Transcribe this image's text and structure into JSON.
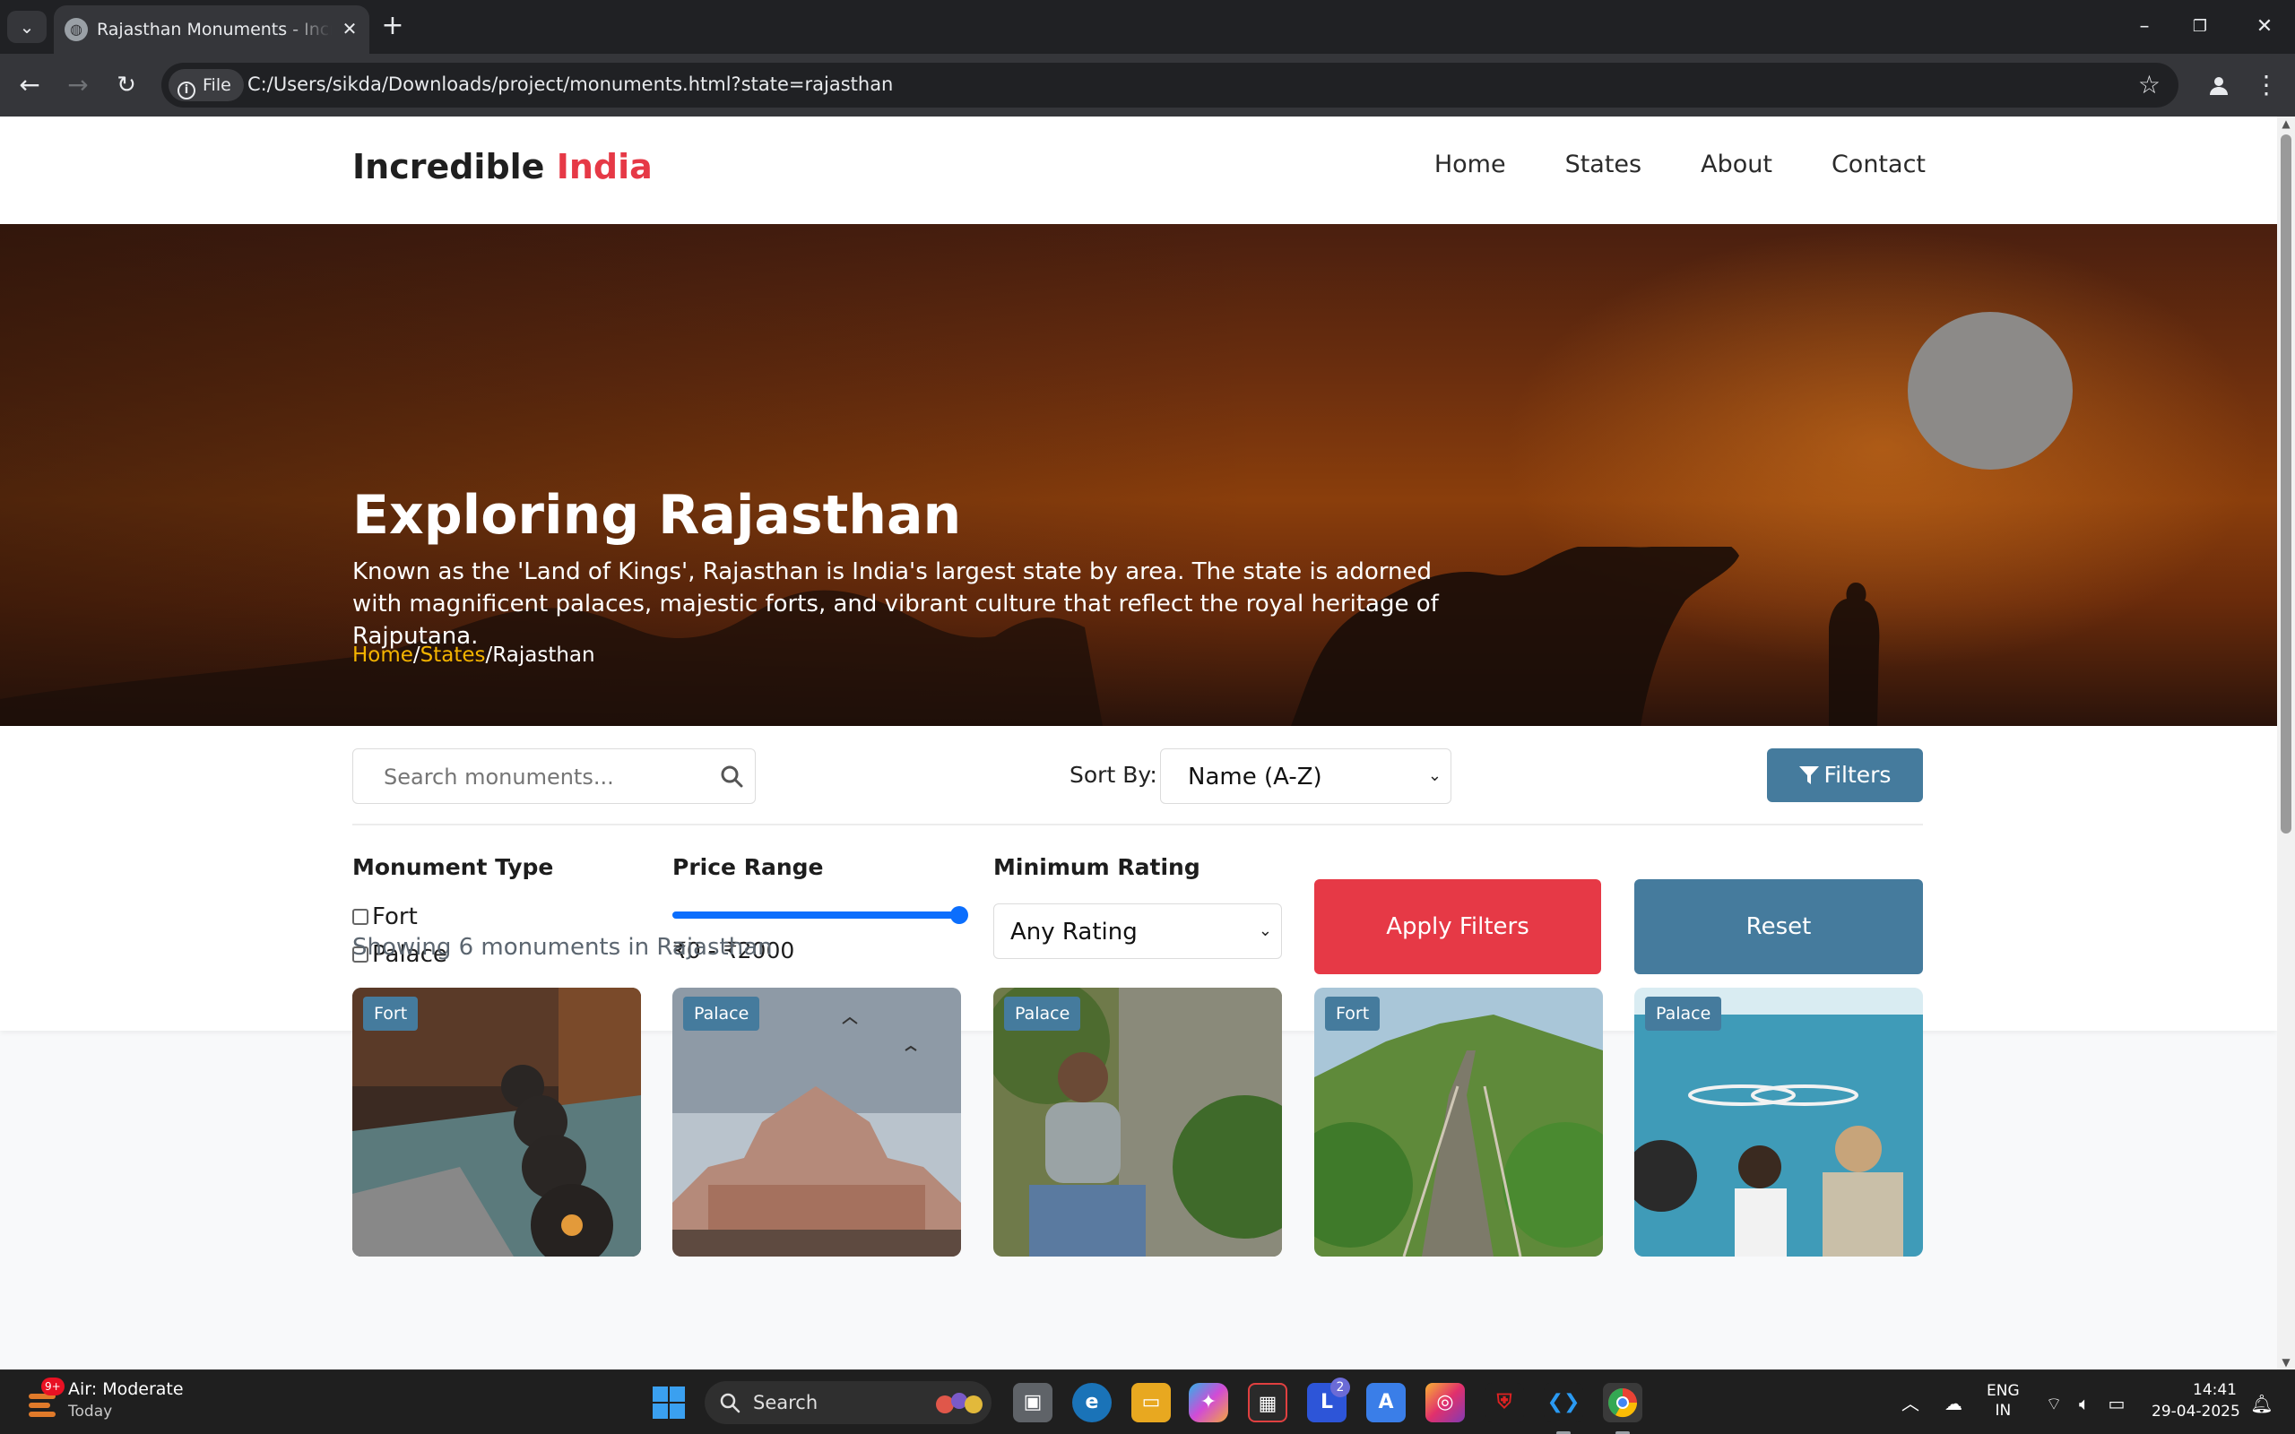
{
  "browser": {
    "tab_title": "Rajasthan Monuments - Incredible India",
    "address_chip": "File",
    "url": "C:/Users/sikda/Downloads/project/monuments.html?state=rajasthan"
  },
  "site": {
    "logo_main": "Incredible",
    "logo_accent": "India",
    "nav": [
      "Home",
      "States",
      "About",
      "Contact"
    ]
  },
  "hero": {
    "title": "Exploring Rajasthan",
    "description": "Known as the 'Land of Kings', Rajasthan is India's largest state by area. The state is adorned with magnificent palaces, majestic forts, and vibrant culture that reflect the royal heritage of Rajputana.",
    "breadcrumb": [
      "Home",
      "/",
      "States",
      "/",
      "Rajasthan"
    ]
  },
  "controls": {
    "search_placeholder": "Search monuments...",
    "sort_label": "Sort By:",
    "sort_value": "Name (A-Z)",
    "filters_button": "Filters"
  },
  "filters": {
    "type_title": "Monument Type",
    "types": [
      {
        "label": "Fort",
        "checked": false
      },
      {
        "label": "Palace",
        "checked": false
      }
    ],
    "price_title": "Price Range",
    "price_readout": "₹0 - ₹2000",
    "price_fraction": 1.0,
    "rating_title": "Minimum Rating",
    "rating_value": "Any Rating",
    "apply_button": "Apply Filters",
    "reset_button": "Reset"
  },
  "results": {
    "summary": "Showing 6 monuments in Rajasthan",
    "cards": [
      {
        "badge": "Fort"
      },
      {
        "badge": "Palace"
      },
      {
        "badge": "Palace"
      },
      {
        "badge": "Fort"
      },
      {
        "badge": "Palace"
      }
    ]
  },
  "taskbar": {
    "weather_badge": "9+",
    "weather_title": "Air: Moderate",
    "weather_sub": "Today",
    "search_text": "Search",
    "app_badge": "2",
    "lang_line1": "ENG",
    "lang_line2": "IN",
    "time": "14:41",
    "date": "29-04-2025"
  },
  "colors": {
    "accent_red": "#e63946",
    "accent_blue": "#457b9d",
    "breadcrumb_link": "#f4b400",
    "range_blue": "#0b6efd"
  }
}
